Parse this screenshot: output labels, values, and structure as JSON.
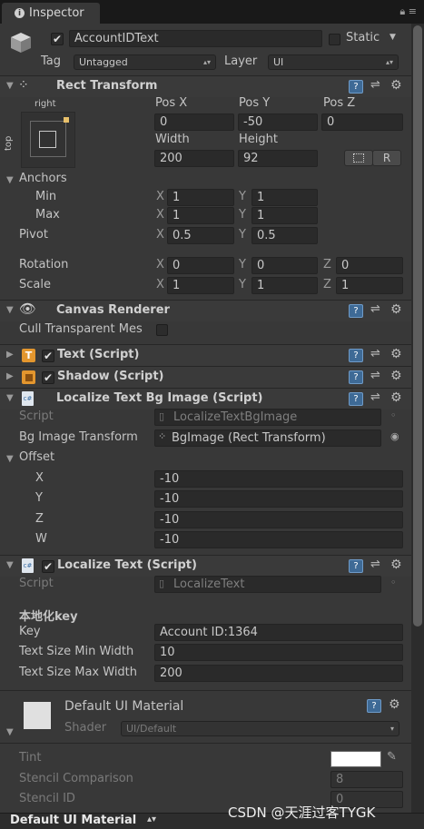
{
  "tab": {
    "title": "Inspector"
  },
  "object": {
    "enabled": true,
    "name": "AccountIDText",
    "static_label": "Static",
    "tag_label": "Tag",
    "tag_value": "Untagged",
    "layer_label": "Layer",
    "layer_value": "UI"
  },
  "rect_transform": {
    "title": "Rect Transform",
    "anchor_h": "right",
    "anchor_v": "top",
    "pos_x_label": "Pos X",
    "pos_y_label": "Pos Y",
    "pos_z_label": "Pos Z",
    "pos_x": "0",
    "pos_y": "-50",
    "pos_z": "0",
    "width_label": "Width",
    "height_label": "Height",
    "width": "200",
    "height": "92",
    "r_button": "R",
    "anchors_label": "Anchors",
    "min_label": "Min",
    "max_label": "Max",
    "min_x": "1",
    "min_y": "1",
    "max_x": "1",
    "max_y": "1",
    "pivot_label": "Pivot",
    "pivot_x": "0.5",
    "pivot_y": "0.5",
    "rotation_label": "Rotation",
    "rot_x": "0",
    "rot_y": "0",
    "rot_z": "0",
    "scale_label": "Scale",
    "scale_x": "1",
    "scale_y": "1",
    "scale_z": "1",
    "x": "X",
    "y": "Y",
    "z": "Z"
  },
  "canvas_renderer": {
    "title": "Canvas Renderer",
    "cull_label": "Cull Transparent Mes"
  },
  "text_script": {
    "title": "Text (Script)",
    "icon": "T"
  },
  "shadow_script": {
    "title": "Shadow (Script)"
  },
  "localize_bg": {
    "title": "Localize Text Bg Image (Script)",
    "script_label": "Script",
    "script_value": "LocalizeTextBgImage",
    "bg_label": "Bg Image Transform",
    "bg_value": "BgImage (Rect Transform)",
    "offset_label": "Offset",
    "x_label": "X",
    "y_label": "Y",
    "z_label": "Z",
    "w_label": "W",
    "x": "-10",
    "y": "-10",
    "z": "-10",
    "w": "-10"
  },
  "localize_text": {
    "title": "Localize Text (Script)",
    "script_label": "Script",
    "script_value": "LocalizeText",
    "section": "本地化key",
    "key_label": "Key",
    "key_value": "Account ID:1364",
    "min_label": "Text Size Min Width",
    "min_value": "10",
    "max_label": "Text Size Max Width",
    "max_value": "200"
  },
  "material": {
    "title": "Default UI Material",
    "shader_label": "Shader",
    "shader_value": "UI/Default",
    "tint_label": "Tint",
    "stencil_comp_label": "Stencil Comparison",
    "stencil_comp_value": "8",
    "stencil_id_label": "Stencil ID",
    "stencil_id_value": "0"
  },
  "bottom": {
    "label": "Default UI Material"
  },
  "watermark": "CSDN @天涯过客TYGK",
  "colors": {
    "background": "#383838",
    "field": "#2a2a2a",
    "help_icon": "#3e6a96"
  }
}
